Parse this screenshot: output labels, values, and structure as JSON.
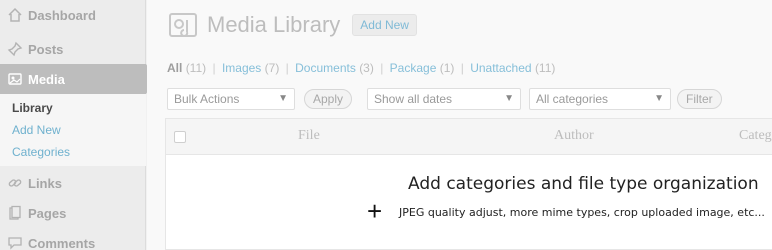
{
  "sidebar": {
    "items": [
      {
        "label": "Dashboard",
        "icon": "home-icon"
      },
      {
        "label": "Posts",
        "icon": "pin-icon"
      },
      {
        "label": "Media",
        "icon": "media-icon"
      },
      {
        "label": "Links",
        "icon": "link-icon"
      },
      {
        "label": "Pages",
        "icon": "pages-icon"
      },
      {
        "label": "Comments",
        "icon": "comments-icon"
      }
    ],
    "submenu": [
      "Library",
      "Add New",
      "Categories"
    ]
  },
  "header": {
    "title": "Media Library",
    "add_new": "Add New"
  },
  "filters": {
    "all": "All",
    "all_count": "(11)",
    "images": "Images",
    "images_count": "(7)",
    "documents": "Documents",
    "documents_count": "(3)",
    "package": "Package",
    "package_count": "(1)",
    "unattached": "Unattached",
    "unattached_count": "(11)",
    "sep": "|"
  },
  "tablenav": {
    "bulk_actions": "Bulk Actions",
    "apply": "Apply",
    "dates": "Show all dates",
    "categories": "All categories",
    "filter": "Filter",
    "caret": "▼"
  },
  "table": {
    "columns": [
      "File",
      "Author",
      "Categ"
    ]
  },
  "banner": {
    "title": "Add categories and file type organization",
    "plus": "+",
    "subtitle": "JPEG quality adjust, more mime types, crop uploaded image, etc..."
  },
  "colors": {
    "link": "#86bfd9",
    "active_menu": "#bdbdbd"
  }
}
